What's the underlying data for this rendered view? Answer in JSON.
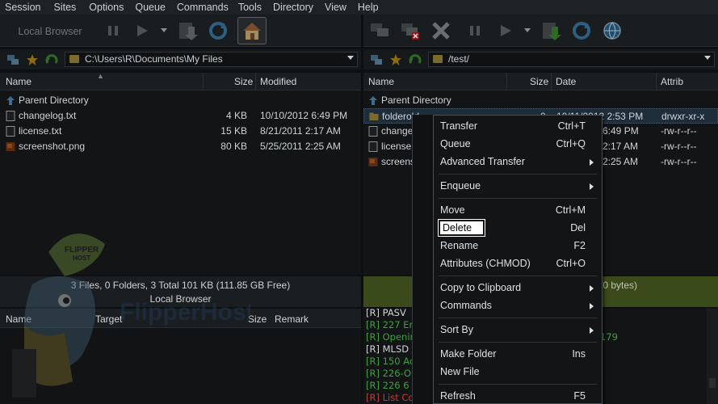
{
  "menu": [
    "Session",
    "Sites",
    "Options",
    "Queue",
    "Commands",
    "Tools",
    "Directory",
    "View",
    "Help"
  ],
  "toolbar": {
    "local_browser_label": "Local Browser"
  },
  "left_address": {
    "path": "C:\\Users\\R\\Documents\\My Files"
  },
  "right_address": {
    "path": "/test/"
  },
  "left_pane": {
    "columns": [
      "Name",
      "Size",
      "Modified"
    ],
    "rows": [
      {
        "name": "Parent Directory",
        "size": "",
        "modified": ""
      },
      {
        "name": "changelog.txt",
        "size": "4 KB",
        "modified": "10/10/2012 6:49 PM"
      },
      {
        "name": "license.txt",
        "size": "15 KB",
        "modified": "8/21/2011 2:17 AM"
      },
      {
        "name": "screenshot.png",
        "size": "80 KB",
        "modified": "5/25/2011 2:25 AM"
      }
    ],
    "status_line1": "3 Files, 0 Folders, 3 Total 101 KB (111.85 GB Free)",
    "status_line2": "Local Browser"
  },
  "right_pane": {
    "columns": [
      "Name",
      "Size",
      "Date",
      "Attrib"
    ],
    "rows": [
      {
        "name": "Parent Directory",
        "size": "",
        "date": "",
        "attrib": ""
      },
      {
        "name": "folderold",
        "size": "0",
        "date": "10/11/2012 2:53 PM",
        "attrib": "drwxr-xr-x"
      },
      {
        "name": "change",
        "size": "",
        "date": "6:49 PM",
        "attrib": "-rw-r--r--"
      },
      {
        "name": "license.",
        "size": "",
        "date": "2:17 AM",
        "attrib": "-rw-r--r--"
      },
      {
        "name": "screens",
        "size": "",
        "date": "2:25 AM",
        "attrib": "-rw-r--r--"
      }
    ],
    "status_text": "0 bytes)"
  },
  "queue": {
    "columns": [
      "Name",
      "Target",
      "Size",
      "Remark"
    ]
  },
  "log": {
    "lines": [
      {
        "text": "[R] PASV",
        "color": "#cfd3d6"
      },
      {
        "text": "[R] 227 Ente",
        "color": "#3fa03f"
      },
      {
        "text": "[R] Openin",
        "color": "#3fa03f"
      },
      {
        "text": "[R] MLSD",
        "color": "#cfd3d6"
      },
      {
        "text": "[R] 150 Acc",
        "color": "#3fa03f"
      },
      {
        "text": "[R] 226-Opt",
        "color": "#3fa03f"
      },
      {
        "text": "[R] 226 6 m",
        "color": "#3fa03f"
      },
      {
        "text": "[R] List Cor",
        "color": "#c23b3b"
      }
    ],
    "fragment": "179"
  },
  "watermark": {
    "brand": "FlipperHost",
    "hat_text": "FLIPPER HOST"
  },
  "context_menu": {
    "items": [
      {
        "label": "Transfer",
        "key": "Ctrl+T",
        "submenu": false
      },
      {
        "label": "Queue",
        "key": "Ctrl+Q",
        "submenu": false
      },
      {
        "label": "Advanced Transfer",
        "key": "",
        "submenu": true
      },
      {
        "label": "Enqueue",
        "key": "",
        "submenu": true
      },
      {
        "label": "Move",
        "key": "Ctrl+M",
        "submenu": false
      },
      {
        "label": "Delete",
        "key": "Del",
        "submenu": false
      },
      {
        "label": "Rename",
        "key": "F2",
        "submenu": false
      },
      {
        "label": "Attributes (CHMOD)",
        "key": "Ctrl+O",
        "submenu": false
      },
      {
        "label": "Copy to Clipboard",
        "key": "",
        "submenu": true
      },
      {
        "label": "Commands",
        "key": "",
        "submenu": true
      },
      {
        "label": "Sort By",
        "key": "",
        "submenu": true
      },
      {
        "label": "Make Folder",
        "key": "Ins",
        "submenu": false
      },
      {
        "label": "New File",
        "key": "",
        "submenu": false
      },
      {
        "label": "Refresh",
        "key": "F5",
        "submenu": false
      }
    ]
  }
}
